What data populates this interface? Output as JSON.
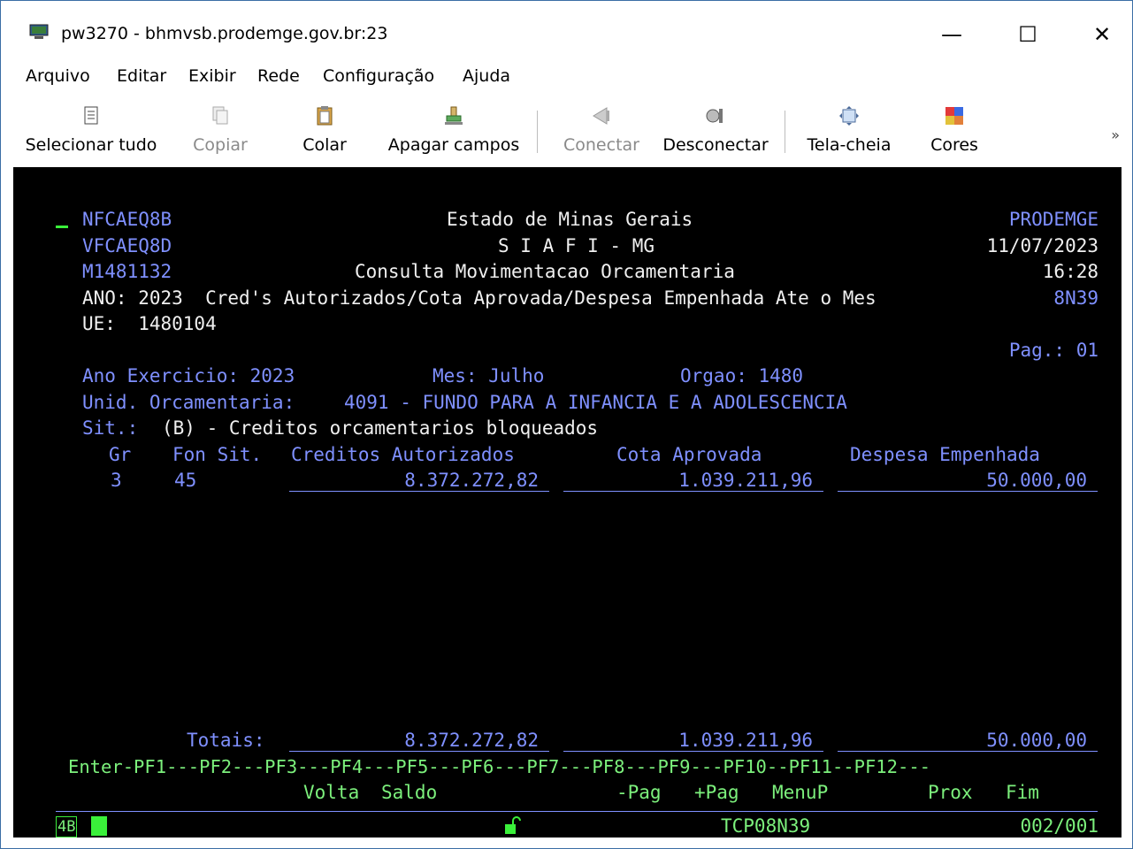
{
  "window": {
    "title": "pw3270 - bhmvsb.prodemge.gov.br:23",
    "minimize_label": "—",
    "maximize_label": "☐",
    "close_label": "✕"
  },
  "menu": [
    {
      "label": "Arquivo"
    },
    {
      "label": "Editar"
    },
    {
      "label": "Exibir"
    },
    {
      "label": "Rede"
    },
    {
      "label": "Configuração"
    },
    {
      "label": "Ajuda"
    }
  ],
  "toolbar": {
    "select_all": "Selecionar tudo",
    "copy": "Copiar",
    "paste": "Colar",
    "clear_fields": "Apagar campos",
    "connect": "Conectar",
    "disconnect": "Desconectar",
    "fullscreen": "Tela-cheia",
    "colors": "Cores",
    "more": "»"
  },
  "terminal": {
    "header": {
      "prog1": "NFCAEQ8B",
      "prog2": "VFCAEQ8D",
      "user": "M1481132",
      "org_title": "Estado de Minas Gerais",
      "system_title": "S I A F I - MG",
      "screen_title": "Consulta Movimentacao Orcamentaria",
      "company": "PRODEMGE",
      "date": "11/07/2023",
      "time": "16:28",
      "screen_code": "8N39",
      "ano_line": "ANO: 2023  Cred's Autorizados/Cota Aprovada/Despesa Empenhada Ate o Mes",
      "ue_line": "UE:  1480104",
      "page": "Pag.: 01"
    },
    "filters": {
      "ano_exercicio": "Ano Exercicio: 2023",
      "mes": "Mes: Julho",
      "orgao": "Orgao: 1480",
      "unid_label": "Unid. Orcamentaria:",
      "unid_value": "4091 - FUNDO PARA A INFANCIA E A ADOLESCENCIA",
      "sit_label": "Sit.:",
      "sit_value": "(B) - Creditos orcamentarios bloqueados"
    },
    "table": {
      "columns": [
        "Gr",
        "Fon Sit.",
        "Creditos Autorizados",
        "Cota Aprovada",
        "Despesa Empenhada"
      ],
      "rows": [
        {
          "gr": "3",
          "fon": "45",
          "creditos": "8.372.272,82",
          "cota": "1.039.211,96",
          "despesa": "50.000,00"
        }
      ],
      "totals_label": "Totais:",
      "totals": {
        "creditos": "8.372.272,82",
        "cota": "1.039.211,96",
        "despesa": "50.000,00"
      }
    },
    "pf_line": "Enter-PF1---PF2---PF3---PF4---PF5---PF6---PF7---PF8---PF9---PF10--PF11--PF12---",
    "pf_labels": {
      "volta": "Volta",
      "saldo": "Saldo",
      "pag_minus": "-Pag",
      "pag_plus": "+Pag",
      "menup": "MenuP",
      "prox": "Prox",
      "fim": "Fim"
    },
    "status": {
      "indicator": "4B",
      "terminal_id": "TCP08N39",
      "cursor_pos": "002/001"
    }
  }
}
